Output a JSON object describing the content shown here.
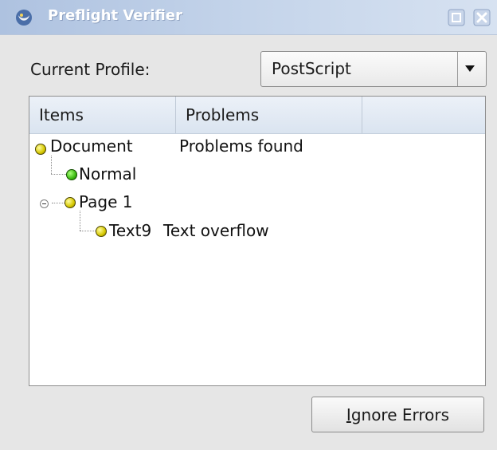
{
  "window": {
    "title": "Preflight Verifier",
    "icons": {
      "app": "scribus-app-icon",
      "maximize": "maximize-icon",
      "close": "close-icon"
    }
  },
  "profile": {
    "label": "Current Profile:",
    "selected": "PostScript"
  },
  "tree": {
    "columns": [
      "Items",
      "Problems"
    ],
    "rows": [
      {
        "item": "Document",
        "problem": "Problems found",
        "status": "warning",
        "status_color": "#d6c800"
      },
      {
        "item": "Normal",
        "problem": "",
        "status": "ok",
        "status_color": "#3dbb12"
      },
      {
        "item": "Page 1",
        "problem": "",
        "status": "warning",
        "status_color": "#d6c800"
      },
      {
        "item": "Text9",
        "problem": "Text overflow",
        "status": "warning",
        "status_color": "#d6c800"
      }
    ]
  },
  "actions": {
    "ignore_errors": {
      "mnemonic": "I",
      "rest": "gnore Errors"
    }
  }
}
